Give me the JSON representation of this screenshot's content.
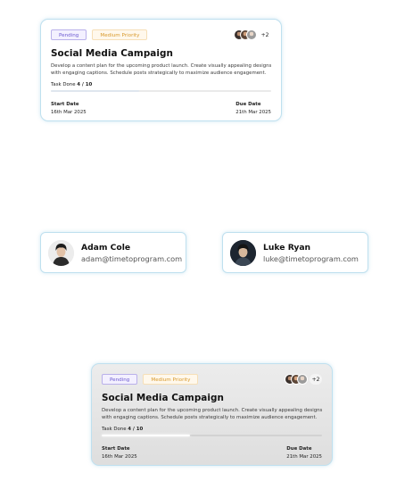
{
  "cards": [
    {
      "status": "Pending",
      "priority": "Medium Priority",
      "more_assignees": "+2",
      "title": "Social Media Campaign",
      "description": "Develop a content plan for the upcoming product launch. Create visually appealing designs with engaging captions. Schedule posts strategically to maximize audience engagement.",
      "task_label": "Task Done",
      "task_count": "4 / 10",
      "progress_fraction": 0.4,
      "start_label": "Start Date",
      "start_value": "16th Mar 2025",
      "due_label": "Due Date",
      "due_value": "21th Mar 2025"
    },
    {
      "status": "Pending",
      "priority": "Medium Priority",
      "more_assignees": "+2",
      "title": "Social Media Campaign",
      "description": "Develop a content plan for the upcoming product launch. Create visually appealing designs with engaging captions. Schedule posts strategically to maximize audience engagement.",
      "task_label": "Task Done",
      "task_count": "4 / 10",
      "progress_fraction": 0.4,
      "start_label": "Start Date",
      "start_value": "16th Mar 2025",
      "due_label": "Due Date",
      "due_value": "21th Mar 2025"
    }
  ],
  "users": [
    {
      "name": "Adam Cole",
      "email": "adam@timetoprogram.com"
    },
    {
      "name": "Luke Ryan",
      "email": "luke@timetoprogram.com"
    }
  ],
  "colors": {
    "border": "#bfe0ef",
    "pending": "#6d5bd0",
    "priority": "#d8992b"
  }
}
